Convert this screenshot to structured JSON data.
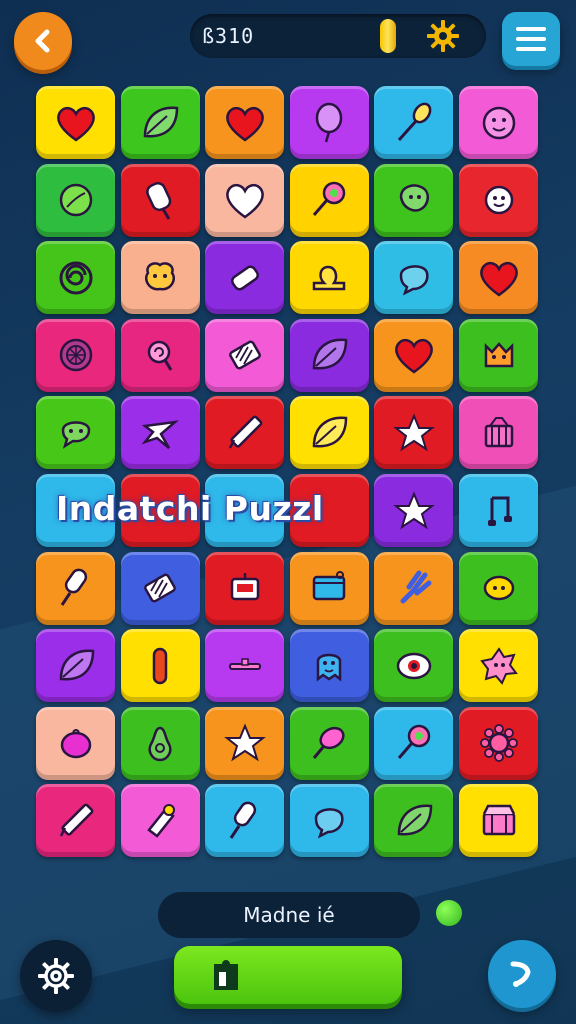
{
  "header": {
    "score": "ß310",
    "back_icon": "chevron-left-icon",
    "coin_icon": "coin-icon",
    "sun_icon": "sun-gear-icon",
    "menu_icon": "hamburger-menu-icon"
  },
  "banner": {
    "title": "Indatchi Puzzl"
  },
  "colors": {
    "yellow": "#ffd400",
    "green": "#3ec41c",
    "orange": "#f7941d",
    "purple": "#b33cf0",
    "cyan": "#2fb5e8",
    "pink": "#f04fd0",
    "red": "#e31b2b",
    "peach": "#f9b59a",
    "violet": "#7a2ad6",
    "magenta": "#e8277d",
    "blue": "#3f5fe0",
    "lime": "#9ae01a"
  },
  "board": {
    "rows": [
      [
        {
          "color": "#ffe000",
          "icon": "heart-icon"
        },
        {
          "color": "#3cc61e",
          "icon": "leaf-icon"
        },
        {
          "color": "#f7941d",
          "icon": "heart-icon"
        },
        {
          "color": "#b83af0",
          "icon": "balloon-icon"
        },
        {
          "color": "#2fb8ea",
          "icon": "whisk-icon"
        },
        {
          "color": "#f25ad6",
          "icon": "face-icon"
        }
      ],
      [
        {
          "color": "#2ebd3e",
          "icon": "lime-icon"
        },
        {
          "color": "#e01b24",
          "icon": "ice-pop-icon"
        },
        {
          "color": "#f9b7a0",
          "icon": "heart-outline-icon"
        },
        {
          "color": "#ffd200",
          "icon": "lollipop-icon"
        },
        {
          "color": "#3ec41c",
          "icon": "blob-icon"
        },
        {
          "color": "#e7262d",
          "icon": "sun-face-icon"
        }
      ],
      [
        {
          "color": "#45c41a",
          "icon": "swirl-icon"
        },
        {
          "color": "#f9b08e",
          "icon": "cookie-icon"
        },
        {
          "color": "#8a2be0",
          "icon": "candy-bar-icon"
        },
        {
          "color": "#ffd800",
          "icon": "duck-icon"
        },
        {
          "color": "#2fbde6",
          "icon": "bubble-icon"
        },
        {
          "color": "#f58b22",
          "icon": "heart-icon"
        }
      ],
      [
        {
          "color": "#e8277d",
          "icon": "citrus-icon"
        },
        {
          "color": "#e62680",
          "icon": "candy-icon"
        },
        {
          "color": "#f25ad6",
          "icon": "grill-icon"
        },
        {
          "color": "#8a2be0",
          "icon": "leaf-icon"
        },
        {
          "color": "#f7941d",
          "icon": "heart-icon"
        },
        {
          "color": "#3dbf1f",
          "icon": "cat-icon"
        }
      ],
      [
        {
          "color": "#47c819",
          "icon": "chat-icon"
        },
        {
          "color": "#9b2ee8",
          "icon": "plane-icon"
        },
        {
          "color": "#e01b24",
          "icon": "pencil-icon"
        },
        {
          "color": "#ffe000",
          "icon": "leaf-icon"
        },
        {
          "color": "#e01b24",
          "icon": "star-icon"
        },
        {
          "color": "#f04fb8",
          "icon": "basket-icon"
        }
      ],
      [
        {
          "color": "#2fb8ea",
          "icon": ""
        },
        {
          "color": "#e01b24",
          "icon": ""
        },
        {
          "color": "#2fb8ea",
          "icon": ""
        },
        {
          "color": "#e01b24",
          "icon": ""
        },
        {
          "color": "#8a2be0",
          "icon": "star-icon"
        },
        {
          "color": "#2fb8ea",
          "icon": "music-note-icon"
        }
      ],
      [
        {
          "color": "#f7941d",
          "icon": "popsicle-icon"
        },
        {
          "color": "#3f5fe0",
          "icon": "grill-icon"
        },
        {
          "color": "#e01b24",
          "icon": "tv-icon"
        },
        {
          "color": "#f7941d",
          "icon": "box-icon"
        },
        {
          "color": "#f7941d",
          "icon": "fork-icon"
        },
        {
          "color": "#3dbf1f",
          "icon": "lemon-icon"
        }
      ],
      [
        {
          "color": "#9b2ee8",
          "icon": "leaf-icon"
        },
        {
          "color": "#ffe000",
          "icon": "capsule-icon"
        },
        {
          "color": "#b83af0",
          "icon": "line-icon"
        },
        {
          "color": "#3f5fe0",
          "icon": "ghost-icon"
        },
        {
          "color": "#3dbf1f",
          "icon": "eye-icon"
        },
        {
          "color": "#ffe000",
          "icon": "flower-face-icon"
        }
      ],
      [
        {
          "color": "#f9b7a0",
          "icon": "berry-icon"
        },
        {
          "color": "#3dbf1f",
          "icon": "pear-icon"
        },
        {
          "color": "#f7941d",
          "icon": "star-icon"
        },
        {
          "color": "#3dbf1f",
          "icon": "ice-cream-icon"
        },
        {
          "color": "#2fb8ea",
          "icon": "lollipop-icon"
        },
        {
          "color": "#e01b24",
          "icon": "gear-flower-icon"
        }
      ],
      [
        {
          "color": "#e8277d",
          "icon": "pencil-icon"
        },
        {
          "color": "#f25ad6",
          "icon": "cone-icon"
        },
        {
          "color": "#2fb8ea",
          "icon": "popsicle-icon"
        },
        {
          "color": "#2fb8ea",
          "icon": "bubble-icon"
        },
        {
          "color": "#3dbf1f",
          "icon": "leaf-icon"
        },
        {
          "color": "#ffe000",
          "icon": "treasure-chest-icon"
        }
      ]
    ]
  },
  "footer": {
    "status_text": "Madne ié",
    "settings_icon": "gear-icon",
    "play_icon": "puzzle-piece-icon",
    "next_icon": "arrow-next-icon"
  }
}
